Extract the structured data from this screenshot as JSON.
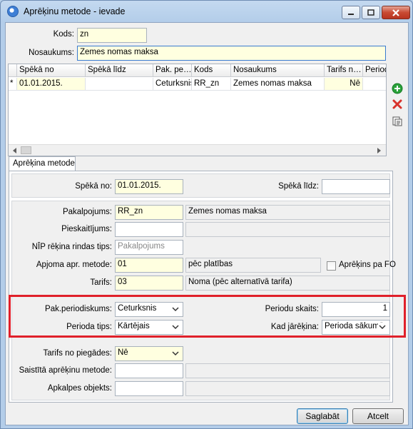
{
  "window": {
    "title": "Aprēķinu metode - ievade"
  },
  "header": {
    "kods_label": "Kods:",
    "kods_value": "zn",
    "nosaukums_label": "Nosaukums:",
    "nosaukums_value": "Zemes nomas maksa"
  },
  "grid": {
    "columns": [
      "Spēkā no",
      "Spēkā līdz",
      "Pak. pe…",
      "Kods",
      "Nosaukums",
      "Tarifs n…",
      "Period"
    ],
    "row_marker": "*",
    "rows": [
      [
        "01.01.2015.",
        "",
        "Ceturksnis",
        "RR_zn",
        "Zemes nomas maksa",
        "Nē",
        ""
      ]
    ]
  },
  "side_icons": [
    "add-icon",
    "delete-icon",
    "details-icon"
  ],
  "colors": {
    "add": "#2aa13a",
    "delete": "#d8322b",
    "highlight": "#e0202a",
    "required": "#ffffe0"
  },
  "tab": {
    "label": "Aprēķina metode"
  },
  "form": {
    "speka_no_label": "Spēkā no:",
    "speka_no_value": "01.01.2015.",
    "speka_lidz_label": "Spēkā līdz:",
    "speka_lidz_value": "",
    "pakalpojums_label": "Pakalpojums:",
    "pakalpojums_code": "RR_zn",
    "pakalpojums_name": "Zemes nomas maksa",
    "pieskaitijums_label": "Pieskaitījums:",
    "pieskaitijums_code": "",
    "pieskaitijums_name": "",
    "nip_label": "NĪP rēķina rindas tips:",
    "nip_placeholder": "Pakalpojums",
    "apjoma_label": "Apjoma apr. metode:",
    "apjoma_code": "01",
    "apjoma_name": "pēc platības",
    "aprekins_checkbox_label": "Aprēķins pa FO",
    "tarifs_label": "Tarifs:",
    "tarifs_code": "03",
    "tarifs_name": "Noma (pēc alternatīvā tarifa)",
    "pak_periodiskums_label": "Pak.periodiskums:",
    "pak_periodiskums_value": "Ceturksnis",
    "periodu_skaits_label": "Periodu skaits:",
    "periodu_skaits_value": "1",
    "perioda_tips_label": "Perioda tips:",
    "perioda_tips_value": "Kārtējais",
    "kad_jarekina_label": "Kad jārēķina:",
    "kad_jarekina_value": "Perioda sākumā",
    "tarifs_no_piegades_label": "Tarifs no piegādes:",
    "tarifs_no_piegades_value": "Nē",
    "saistita_label": "Saistītā aprēķinu metode:",
    "saistita_code": "",
    "saistita_name": "",
    "apkalpes_label": "Apkalpes objekts:",
    "apkalpes_code": "",
    "apkalpes_name": ""
  },
  "buttons": {
    "save": "Saglabāt",
    "cancel": "Atcelt"
  }
}
